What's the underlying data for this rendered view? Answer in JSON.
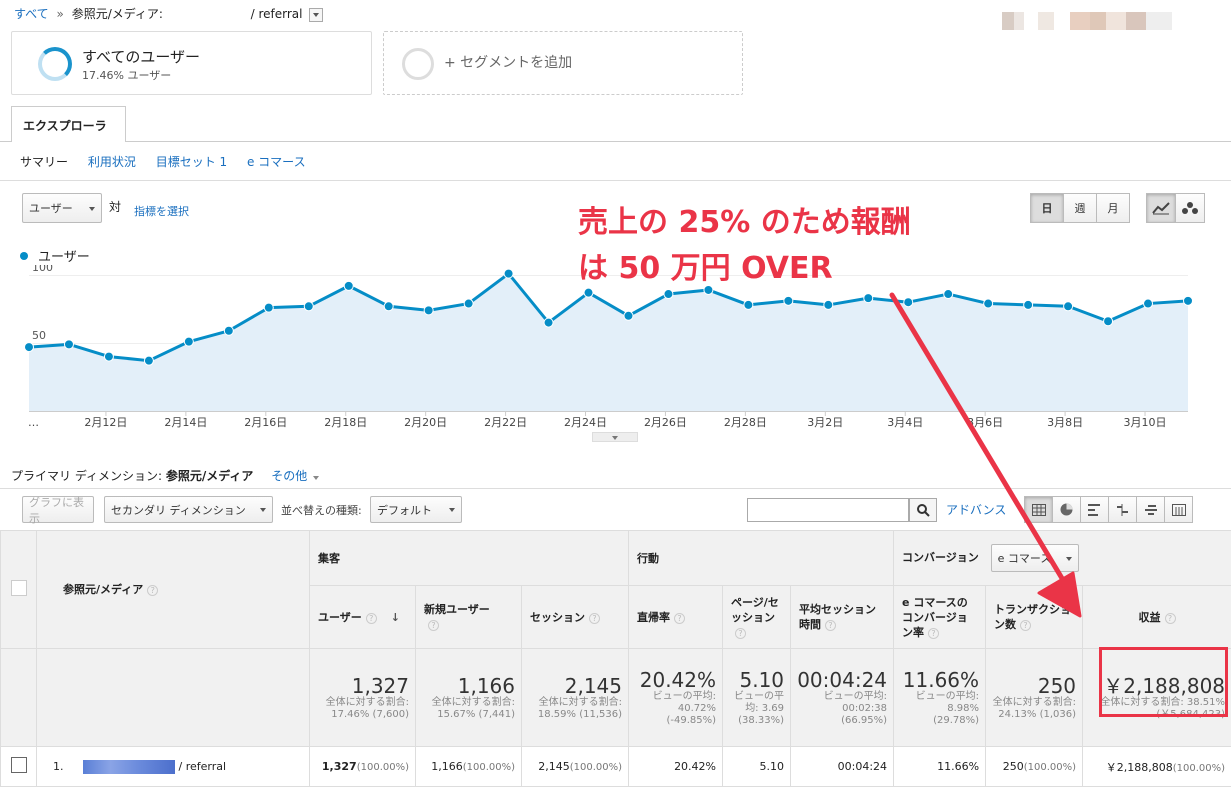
{
  "breadcrumb": {
    "all": "すべて",
    "sep": "»",
    "dimension": "参照元/メディア:",
    "value": "/ referral"
  },
  "segments": {
    "all_title": "すべてのユーザー",
    "all_sub": "17.46% ユーザー",
    "add_label": "+ セグメントを追加"
  },
  "tabs": {
    "explorer": "エクスプローラ"
  },
  "subtabs": [
    "サマリー",
    "利用状況",
    "目標セット 1",
    "e コマース"
  ],
  "chart_controls": {
    "metric": "ユーザー",
    "vs": "対",
    "choose_metric": "指標を選択",
    "period": [
      "日",
      "週",
      "月"
    ]
  },
  "chart_data": {
    "type": "area",
    "series": [
      {
        "name": "ユーザー",
        "values": [
          47,
          49,
          40,
          37,
          51,
          59,
          76,
          77,
          92,
          77,
          74,
          79,
          101,
          65,
          87,
          70,
          86,
          89,
          78,
          81,
          78,
          83,
          80,
          86,
          79,
          78,
          77,
          66,
          79,
          81
        ]
      }
    ],
    "y_ticks": [
      100,
      50
    ],
    "ylim": [
      0,
      100
    ],
    "x_tick_labels": [
      "…",
      "2月12日",
      "2月14日",
      "2月16日",
      "2月18日",
      "2月20日",
      "2月22日",
      "2月24日",
      "2月26日",
      "2月28日",
      "3月2日",
      "3月4日",
      "3月6日",
      "3月8日",
      "3月10日"
    ],
    "color": "#058dc7",
    "fill": "#e3eff9",
    "grid": true
  },
  "annotation": {
    "line1": "売上の 25% のため報酬",
    "line2": "は 50 万円 OVER",
    "color": "#ea3447"
  },
  "table_controls": {
    "primary_label": "プライマリ ディメンション:",
    "primary_value": "参照元/メディア",
    "other": "その他",
    "graph_button": "グラフに表示",
    "secondary": "セカンダリ ディメンション",
    "sort_label": "並べ替えの種類:",
    "sort_value": "デフォルト",
    "search_placeholder": "",
    "advanced": "アドバンス"
  },
  "table": {
    "groups": {
      "acquisition": "集客",
      "behavior": "行動",
      "conversion": "コンバージョン",
      "conversion_select": "e コマース"
    },
    "dim_header": "参照元/メディア",
    "headers": [
      "ユーザー",
      "新規ユーザー",
      "セッション",
      "直帰率",
      "ページ/セッション",
      "平均セッション時間",
      "e コマースのコンバージョン率",
      "トランザクション数",
      "収益"
    ],
    "summary": [
      {
        "big": "1,327",
        "small": "全体に対する割合: 17.46% (7,600)"
      },
      {
        "big": "1,166",
        "small": "全体に対する割合: 15.67% (7,441)"
      },
      {
        "big": "2,145",
        "small": "全体に対する割合: 18.59% (11,536)"
      },
      {
        "big": "20.42%",
        "small": "ビューの平均: 40.72% (-49.85%)"
      },
      {
        "big": "5.10",
        "small": "ビューの平均: 3.69 (38.33%)"
      },
      {
        "big": "00:04:24",
        "small": "ビューの平均: 00:02:38 (66.95%)"
      },
      {
        "big": "11.66%",
        "small": "ビューの平均: 8.98% (29.78%)"
      },
      {
        "big": "250",
        "small": "全体に対する割合: 24.13% (1,036)"
      },
      {
        "big": "￥2,188,808",
        "small": "全体に対する割合: 38.51% (￥5,684,423)"
      }
    ],
    "row": {
      "index": "1.",
      "source": "/ referral",
      "cells": [
        {
          "v": "1,327",
          "p": "(100.00%)"
        },
        {
          "v": "1,166",
          "p": "(100.00%)"
        },
        {
          "v": "2,145",
          "p": "(100.00%)"
        },
        {
          "v": "20.42%",
          "p": ""
        },
        {
          "v": "5.10",
          "p": ""
        },
        {
          "v": "00:04:24",
          "p": ""
        },
        {
          "v": "11.66%",
          "p": ""
        },
        {
          "v": "250",
          "p": "(100.00%)"
        },
        {
          "v": "￥2,188,808",
          "p": "(100.00%)"
        }
      ]
    }
  }
}
